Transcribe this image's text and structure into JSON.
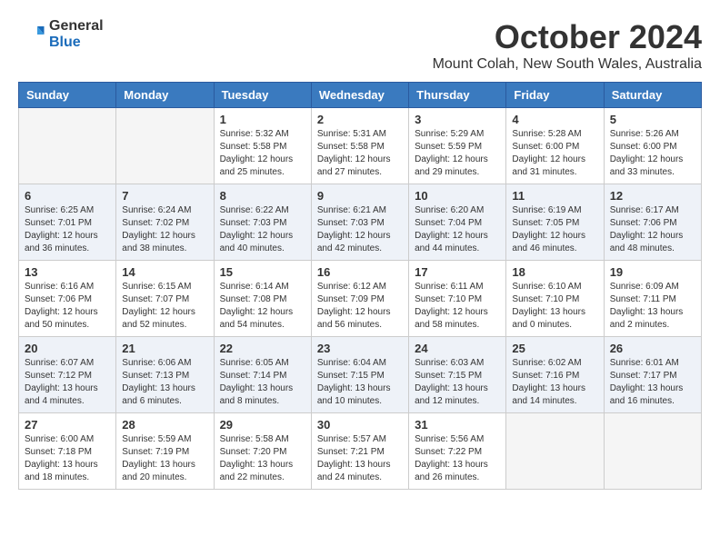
{
  "logo": {
    "general": "General",
    "blue": "Blue"
  },
  "title": "October 2024",
  "location": "Mount Colah, New South Wales, Australia",
  "days_header": [
    "Sunday",
    "Monday",
    "Tuesday",
    "Wednesday",
    "Thursday",
    "Friday",
    "Saturday"
  ],
  "weeks": [
    [
      {
        "day": "",
        "info": ""
      },
      {
        "day": "",
        "info": ""
      },
      {
        "day": "1",
        "info": "Sunrise: 5:32 AM\nSunset: 5:58 PM\nDaylight: 12 hours\nand 25 minutes."
      },
      {
        "day": "2",
        "info": "Sunrise: 5:31 AM\nSunset: 5:58 PM\nDaylight: 12 hours\nand 27 minutes."
      },
      {
        "day": "3",
        "info": "Sunrise: 5:29 AM\nSunset: 5:59 PM\nDaylight: 12 hours\nand 29 minutes."
      },
      {
        "day": "4",
        "info": "Sunrise: 5:28 AM\nSunset: 6:00 PM\nDaylight: 12 hours\nand 31 minutes."
      },
      {
        "day": "5",
        "info": "Sunrise: 5:26 AM\nSunset: 6:00 PM\nDaylight: 12 hours\nand 33 minutes."
      }
    ],
    [
      {
        "day": "6",
        "info": "Sunrise: 6:25 AM\nSunset: 7:01 PM\nDaylight: 12 hours\nand 36 minutes."
      },
      {
        "day": "7",
        "info": "Sunrise: 6:24 AM\nSunset: 7:02 PM\nDaylight: 12 hours\nand 38 minutes."
      },
      {
        "day": "8",
        "info": "Sunrise: 6:22 AM\nSunset: 7:03 PM\nDaylight: 12 hours\nand 40 minutes."
      },
      {
        "day": "9",
        "info": "Sunrise: 6:21 AM\nSunset: 7:03 PM\nDaylight: 12 hours\nand 42 minutes."
      },
      {
        "day": "10",
        "info": "Sunrise: 6:20 AM\nSunset: 7:04 PM\nDaylight: 12 hours\nand 44 minutes."
      },
      {
        "day": "11",
        "info": "Sunrise: 6:19 AM\nSunset: 7:05 PM\nDaylight: 12 hours\nand 46 minutes."
      },
      {
        "day": "12",
        "info": "Sunrise: 6:17 AM\nSunset: 7:06 PM\nDaylight: 12 hours\nand 48 minutes."
      }
    ],
    [
      {
        "day": "13",
        "info": "Sunrise: 6:16 AM\nSunset: 7:06 PM\nDaylight: 12 hours\nand 50 minutes."
      },
      {
        "day": "14",
        "info": "Sunrise: 6:15 AM\nSunset: 7:07 PM\nDaylight: 12 hours\nand 52 minutes."
      },
      {
        "day": "15",
        "info": "Sunrise: 6:14 AM\nSunset: 7:08 PM\nDaylight: 12 hours\nand 54 minutes."
      },
      {
        "day": "16",
        "info": "Sunrise: 6:12 AM\nSunset: 7:09 PM\nDaylight: 12 hours\nand 56 minutes."
      },
      {
        "day": "17",
        "info": "Sunrise: 6:11 AM\nSunset: 7:10 PM\nDaylight: 12 hours\nand 58 minutes."
      },
      {
        "day": "18",
        "info": "Sunrise: 6:10 AM\nSunset: 7:10 PM\nDaylight: 13 hours\nand 0 minutes."
      },
      {
        "day": "19",
        "info": "Sunrise: 6:09 AM\nSunset: 7:11 PM\nDaylight: 13 hours\nand 2 minutes."
      }
    ],
    [
      {
        "day": "20",
        "info": "Sunrise: 6:07 AM\nSunset: 7:12 PM\nDaylight: 13 hours\nand 4 minutes."
      },
      {
        "day": "21",
        "info": "Sunrise: 6:06 AM\nSunset: 7:13 PM\nDaylight: 13 hours\nand 6 minutes."
      },
      {
        "day": "22",
        "info": "Sunrise: 6:05 AM\nSunset: 7:14 PM\nDaylight: 13 hours\nand 8 minutes."
      },
      {
        "day": "23",
        "info": "Sunrise: 6:04 AM\nSunset: 7:15 PM\nDaylight: 13 hours\nand 10 minutes."
      },
      {
        "day": "24",
        "info": "Sunrise: 6:03 AM\nSunset: 7:15 PM\nDaylight: 13 hours\nand 12 minutes."
      },
      {
        "day": "25",
        "info": "Sunrise: 6:02 AM\nSunset: 7:16 PM\nDaylight: 13 hours\nand 14 minutes."
      },
      {
        "day": "26",
        "info": "Sunrise: 6:01 AM\nSunset: 7:17 PM\nDaylight: 13 hours\nand 16 minutes."
      }
    ],
    [
      {
        "day": "27",
        "info": "Sunrise: 6:00 AM\nSunset: 7:18 PM\nDaylight: 13 hours\nand 18 minutes."
      },
      {
        "day": "28",
        "info": "Sunrise: 5:59 AM\nSunset: 7:19 PM\nDaylight: 13 hours\nand 20 minutes."
      },
      {
        "day": "29",
        "info": "Sunrise: 5:58 AM\nSunset: 7:20 PM\nDaylight: 13 hours\nand 22 minutes."
      },
      {
        "day": "30",
        "info": "Sunrise: 5:57 AM\nSunset: 7:21 PM\nDaylight: 13 hours\nand 24 minutes."
      },
      {
        "day": "31",
        "info": "Sunrise: 5:56 AM\nSunset: 7:22 PM\nDaylight: 13 hours\nand 26 minutes."
      },
      {
        "day": "",
        "info": ""
      },
      {
        "day": "",
        "info": ""
      }
    ]
  ]
}
